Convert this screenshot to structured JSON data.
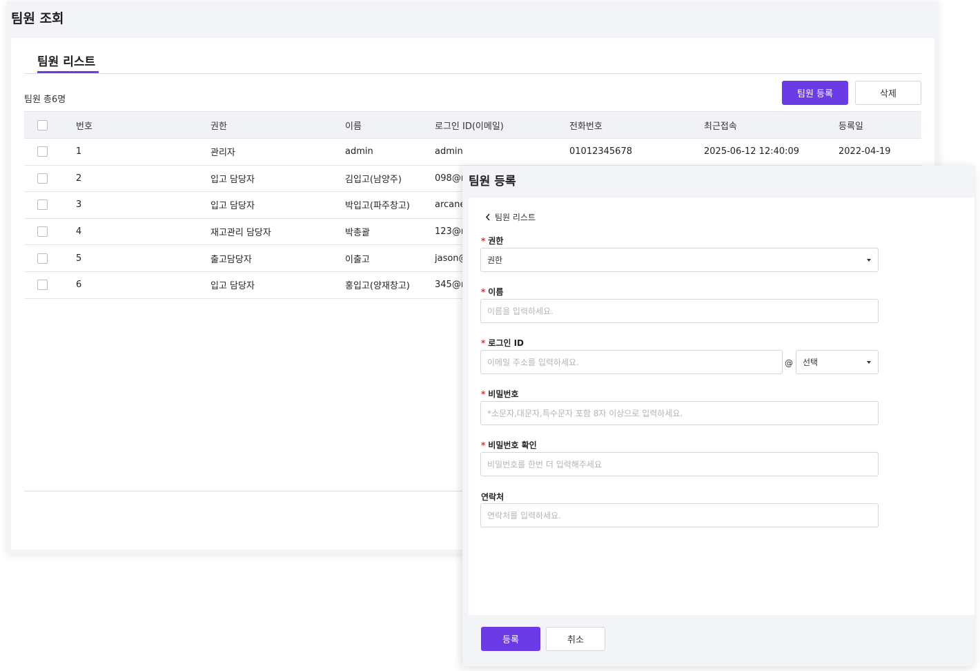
{
  "list_window": {
    "title": "팀원 조회",
    "tab_label": "팀원 리스트",
    "count_text": "팀원 총6명",
    "register_button": "팀원 등록",
    "delete_button": "삭제",
    "columns": [
      "번호",
      "권한",
      "이름",
      "로그인 ID(이메일)",
      "전화번호",
      "최근접속",
      "등록일"
    ],
    "rows": [
      {
        "no": "1",
        "role": "관리자",
        "name": "admin",
        "login_id": "admin",
        "phone": "01012345678",
        "last_login": "2025-06-12 12:40:09",
        "registered": "2022-04-19"
      },
      {
        "no": "2",
        "role": "입고 담당자",
        "name": "김입고(남양주)",
        "login_id": "098@r",
        "phone": "",
        "last_login": "",
        "registered": ""
      },
      {
        "no": "3",
        "role": "입고 담당자",
        "name": "박입고(파주창고)",
        "login_id": "arcane",
        "phone": "",
        "last_login": "",
        "registered": ""
      },
      {
        "no": "4",
        "role": "재고관리 담당자",
        "name": "박총괄",
        "login_id": "123@n",
        "phone": "",
        "last_login": "",
        "registered": ""
      },
      {
        "no": "5",
        "role": "출고담당자",
        "name": "이출고",
        "login_id": "jason@",
        "phone": "",
        "last_login": "",
        "registered": ""
      },
      {
        "no": "6",
        "role": "입고 담당자",
        "name": "홍입고(양재창고)",
        "login_id": "345@r",
        "phone": "",
        "last_login": "",
        "registered": ""
      }
    ]
  },
  "register_window": {
    "title": "팀원 등록",
    "back_label": "팀원 리스트",
    "required_mark": "*",
    "role": {
      "label": "권한",
      "value": "권한"
    },
    "name": {
      "label": "이름",
      "placeholder": "이름을 입력하세요."
    },
    "login_id": {
      "label": "로그인 ID",
      "placeholder": "이메일 주소를 입력하세요.",
      "at": "@",
      "domain_value": "선택"
    },
    "password": {
      "label": "비밀번호",
      "placeholder": "*소문자,대문자,특수문자 포함 8자 이상으로 입력하세요."
    },
    "password_confirm": {
      "label": "비밀번호 확인",
      "placeholder": "비밀번호를 한번 더 입력해주세요"
    },
    "contact": {
      "label": "연락처",
      "placeholder": "연락처를 입력하세요."
    },
    "submit_button": "등록",
    "cancel_button": "취소"
  },
  "colors": {
    "accent": "#6b3ce6",
    "link": "#1f5fbf",
    "required": "#e0323c",
    "panel_bg": "#f3f4f7"
  },
  "icons": {
    "back": "chevron-left-icon",
    "dropdown": "caret-down-icon"
  }
}
